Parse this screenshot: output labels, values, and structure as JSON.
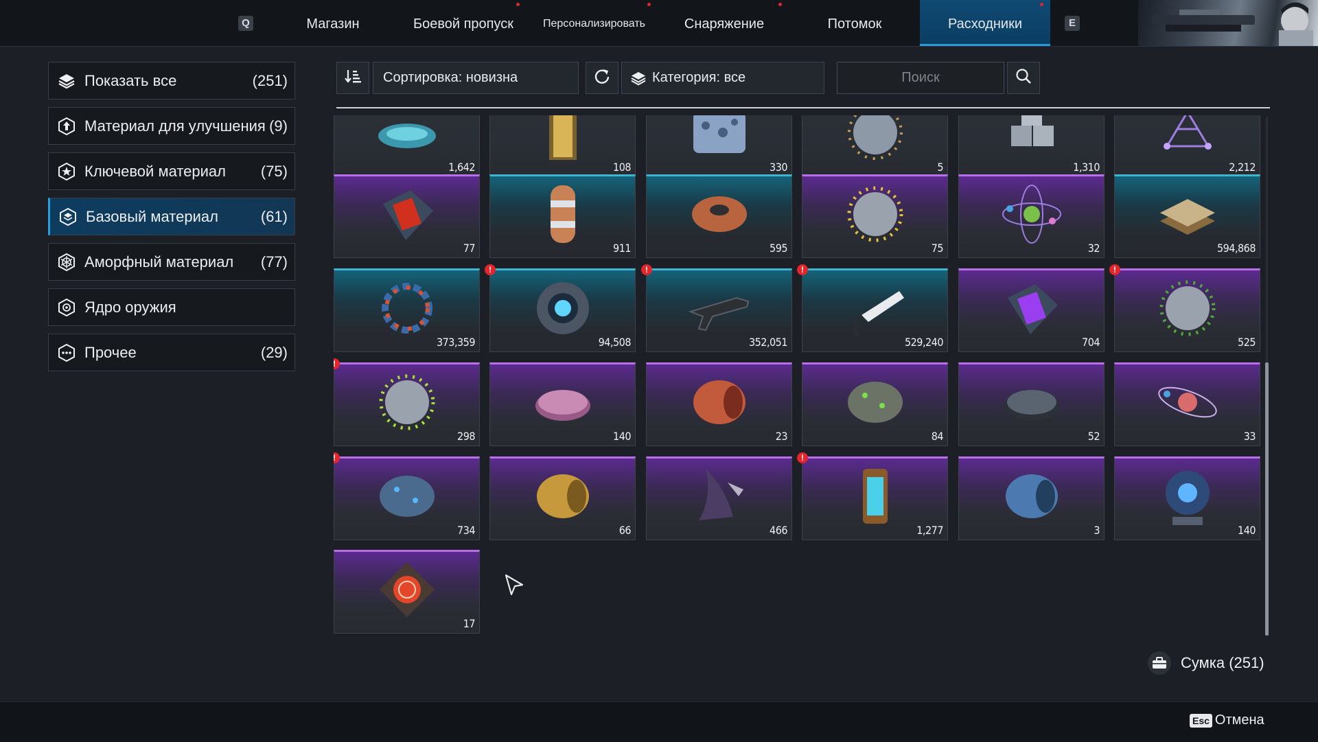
{
  "nav": {
    "key_left": "Q",
    "key_right": "E",
    "tabs": [
      {
        "label": "Магазин",
        "dot": false
      },
      {
        "label": "Боевой пропуск",
        "dot": true
      },
      {
        "label": "Персонализировать",
        "dot": true
      },
      {
        "label": "Снаряжение",
        "dot": true
      },
      {
        "label": "Потомок",
        "dot": false
      },
      {
        "label": "Расходники",
        "dot": true,
        "active": true
      }
    ]
  },
  "sidebar": {
    "items": [
      {
        "label": "Показать все",
        "count": "(251)",
        "icon": "layers-icon"
      },
      {
        "label": "Материал для улучшения",
        "count": "(9)",
        "icon": "upgrade-hexagon-icon"
      },
      {
        "label": "Ключевой материал",
        "count": "(75)",
        "icon": "star-hexagon-icon"
      },
      {
        "label": "Базовый материал",
        "count": "(61)",
        "icon": "stack-hexagon-icon",
        "active": true
      },
      {
        "label": "Аморфный материал",
        "count": "(77)",
        "icon": "web-hexagon-icon"
      },
      {
        "label": "Ядро оружия",
        "count": "",
        "icon": "core-hexagon-icon"
      },
      {
        "label": "Прочее",
        "count": "(29)",
        "icon": "dots-hexagon-icon"
      }
    ]
  },
  "toolbar": {
    "sort_label": "Сортировка: новизна",
    "category_label": "Категория: все",
    "search_placeholder": "Поиск"
  },
  "items": [
    {
      "qty": "1,642",
      "rarity": "gray",
      "icon": "liquid-metal-icon",
      "alert": false
    },
    {
      "qty": "108",
      "rarity": "gray",
      "icon": "gold-cylinder-icon",
      "alert": false
    },
    {
      "qty": "330",
      "rarity": "gray",
      "icon": "porous-block-icon",
      "alert": false
    },
    {
      "qty": "5",
      "rarity": "gray",
      "icon": "virus-gray-icon",
      "alert": false
    },
    {
      "qty": "1,310",
      "rarity": "gray",
      "icon": "metal-cubes-icon",
      "alert": false
    },
    {
      "qty": "2,212",
      "rarity": "gray",
      "icon": "crystal-lattice-icon",
      "alert": false
    },
    {
      "qty": "77",
      "rarity": "purple",
      "icon": "red-chip-case-icon",
      "alert": false
    },
    {
      "qty": "911",
      "rarity": "teal",
      "icon": "copper-capsule-icon",
      "alert": false
    },
    {
      "qty": "595",
      "rarity": "teal",
      "icon": "wire-spool-icon",
      "alert": false
    },
    {
      "qty": "75",
      "rarity": "purple",
      "icon": "virus-yellow-icon",
      "alert": false
    },
    {
      "qty": "32",
      "rarity": "purple",
      "icon": "atom-orbit-icon",
      "alert": false
    },
    {
      "qty": "594,868",
      "rarity": "teal",
      "icon": "fabric-stack-icon",
      "alert": false
    },
    {
      "qty": "373,359",
      "rarity": "teal",
      "icon": "molecule-ring-icon",
      "alert": false
    },
    {
      "qty": "94,508",
      "rarity": "teal",
      "icon": "energy-core-icon",
      "alert": true
    },
    {
      "qty": "352,051",
      "rarity": "teal",
      "icon": "gun-frame-icon",
      "alert": true
    },
    {
      "qty": "529,240",
      "rarity": "teal",
      "icon": "white-tool-icon",
      "alert": true
    },
    {
      "qty": "704",
      "rarity": "purple",
      "icon": "purple-chip-case-icon",
      "alert": false
    },
    {
      "qty": "525",
      "rarity": "purple",
      "icon": "virus-green-icon",
      "alert": true
    },
    {
      "qty": "298",
      "rarity": "purple",
      "icon": "virus-lime-icon",
      "alert": true
    },
    {
      "qty": "140",
      "rarity": "purple",
      "icon": "pink-petri-dish-icon",
      "alert": false
    },
    {
      "qty": "23",
      "rarity": "purple",
      "icon": "copper-coil-icon",
      "alert": false
    },
    {
      "qty": "84",
      "rarity": "purple",
      "icon": "green-brain-icon",
      "alert": false
    },
    {
      "qty": "52",
      "rarity": "purple",
      "icon": "dark-petri-dish-icon",
      "alert": false
    },
    {
      "qty": "33",
      "rarity": "purple",
      "icon": "planet-orbit-icon",
      "alert": false
    },
    {
      "qty": "734",
      "rarity": "purple",
      "icon": "blue-brain-icon",
      "alert": true
    },
    {
      "qty": "66",
      "rarity": "purple",
      "icon": "gold-coil-icon",
      "alert": false
    },
    {
      "qty": "466",
      "rarity": "purple",
      "icon": "alien-blade-icon",
      "alert": false
    },
    {
      "qty": "1,277",
      "rarity": "purple",
      "icon": "lantern-icon",
      "alert": true
    },
    {
      "qty": "3",
      "rarity": "purple",
      "icon": "blue-coil-icon",
      "alert": false
    },
    {
      "qty": "140",
      "rarity": "purple",
      "icon": "orb-container-icon",
      "alert": false
    },
    {
      "qty": "17",
      "rarity": "purple",
      "icon": "seal-plate-icon",
      "alert": false
    }
  ],
  "bag_label": "Сумка (251)",
  "esc_key": "Esc",
  "cancel_label": "Отмена",
  "colors": {
    "purple": "#b86fe8",
    "teal": "#3fb6cf",
    "active_blue": "#2b9ee0",
    "alert_red": "#e3262c"
  }
}
